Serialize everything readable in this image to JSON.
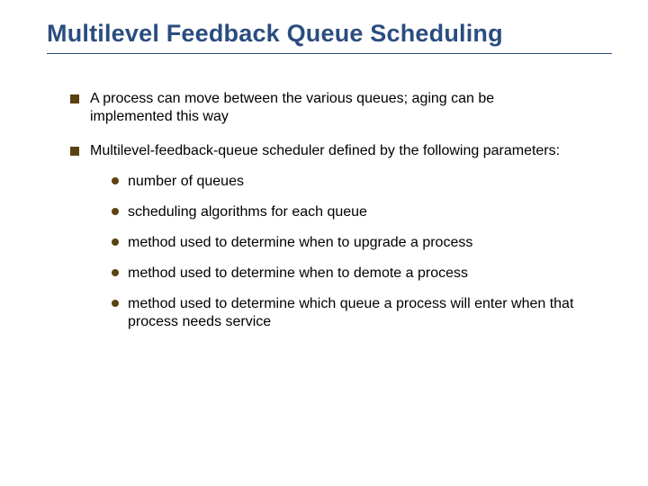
{
  "title": "Multilevel Feedback Queue Scheduling",
  "bullets": [
    {
      "text": "A process can move between the various queues; aging can be implemented this way",
      "sub": []
    },
    {
      "text": "Multilevel-feedback-queue scheduler defined by the following parameters:",
      "sub": [
        "number of queues",
        "scheduling algorithms for each queue",
        "method used to determine when to upgrade a process",
        "method used to determine when to demote a process",
        "method used to determine which queue a process will enter when that process needs service"
      ]
    }
  ]
}
